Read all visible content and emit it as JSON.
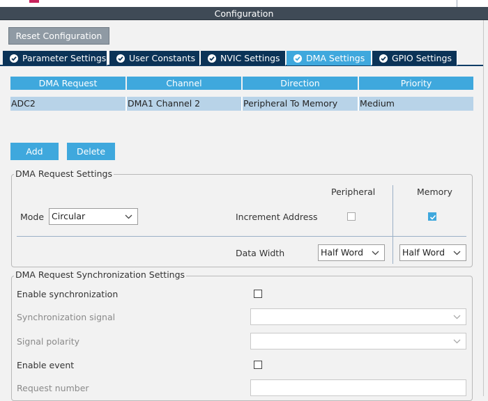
{
  "panel_title": "Configuration",
  "reset_button": "Reset Configuration",
  "tabs": [
    {
      "label": "Parameter Settings"
    },
    {
      "label": "User Constants"
    },
    {
      "label": "NVIC Settings"
    },
    {
      "label": "DMA Settings"
    },
    {
      "label": "GPIO Settings"
    }
  ],
  "active_tab": "DMA Settings",
  "dma_table": {
    "headers": [
      "DMA Request",
      "Channel",
      "Direction",
      "Priority"
    ],
    "rows": [
      [
        "ADC2",
        "DMA1 Channel 2",
        "Peripheral To Memory",
        "Medium"
      ]
    ]
  },
  "add_button": "Add",
  "delete_button": "Delete",
  "request_settings": {
    "legend": "DMA Request Settings",
    "peripheral_header": "Peripheral",
    "memory_header": "Memory",
    "mode_label": "Mode",
    "mode_value": "Circular",
    "increment_label": "Increment Address",
    "peripheral_increment": false,
    "memory_increment": true,
    "data_width_label": "Data Width",
    "peripheral_width": "Half Word",
    "memory_width": "Half Word"
  },
  "sync_settings": {
    "legend": "DMA Request Synchronization Settings",
    "enable_sync_label": "Enable synchronization",
    "enable_sync": false,
    "sync_signal_label": "Synchronization signal",
    "sync_signal_value": "",
    "signal_polarity_label": "Signal polarity",
    "signal_polarity_value": "",
    "enable_event_label": "Enable event",
    "enable_event": false,
    "request_number_label": "Request number",
    "request_number_value": ""
  },
  "colors": {
    "accent": "#3fa8dd",
    "tab_dark": "#0b3357",
    "title_bar": "#3f4a56",
    "row_selected": "#b8d3e8"
  }
}
